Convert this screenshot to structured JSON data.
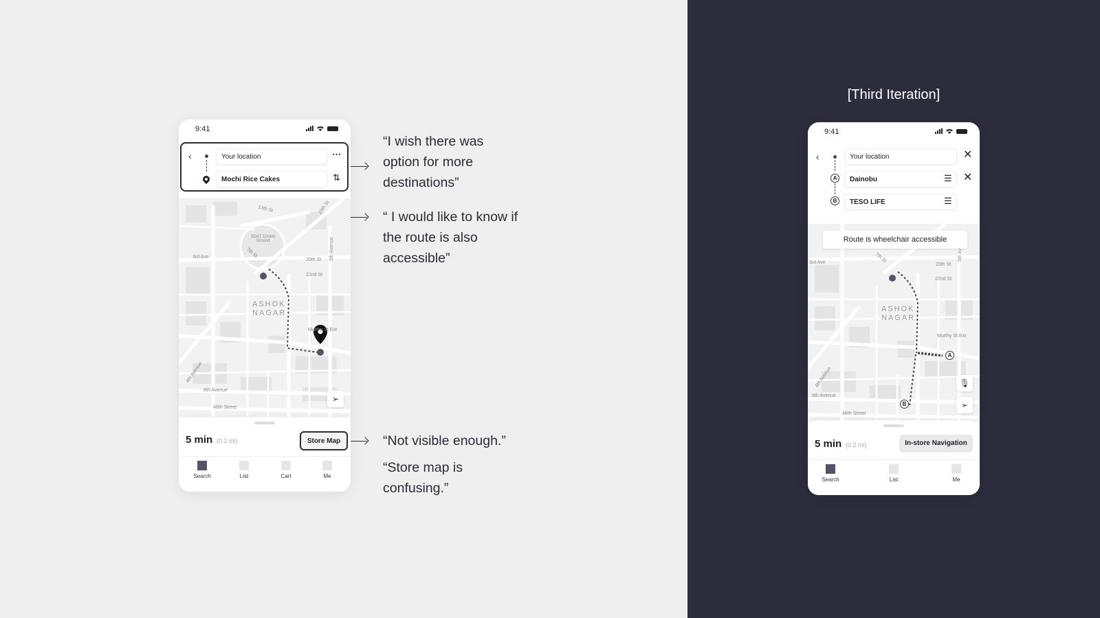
{
  "slide": {
    "iteration_title": "[Third Iteration]"
  },
  "quotes": {
    "q1": "“I wish there was option for more destinations”",
    "q2": "“ I would like to know if the route is also accessible”",
    "q3": "“Not visible enough.”",
    "q4": "“Store map is confusing.”"
  },
  "phone1": {
    "status": {
      "time": "9:41"
    },
    "search": {
      "origin": "Your location",
      "destination": "Mochi Rice Cakes",
      "back_icon": "chevron-left-icon",
      "more_icon": "more-horizontal-icon",
      "swap_icon": "swap-vertical-icon"
    },
    "map": {
      "labels": {
        "street_13th": "13th St",
        "street_15th": "15th St",
        "sdat": "SDAT Cricket Ground",
        "ave_3rd": "3rd Ave",
        "street_7th": "7th St",
        "street_20th": "20th St",
        "ave_5th": "5th Avenue",
        "street_22nd": "22nd St",
        "area": "ASHOK NAGAR",
        "murthy": "Murthy St Ext",
        "ave_4th": "4th Avenue",
        "ave_8th": "8th Avenue",
        "street_46th": "46th Street"
      },
      "locate_icon": "navigation-arrow-icon"
    },
    "sheet": {
      "eta": "5 min",
      "distance": "(0.2 mi)",
      "store_button": "Store Map"
    },
    "nav": [
      {
        "label": "Search",
        "active": true
      },
      {
        "label": "List",
        "active": false
      },
      {
        "label": "Cart",
        "active": false
      },
      {
        "label": "Me",
        "active": false
      }
    ]
  },
  "phone2": {
    "status": {
      "time": "9:41"
    },
    "search": {
      "origin": "Your location",
      "stop_a_badge": "A",
      "stop_a": "Dainobu",
      "stop_b_badge": "B",
      "stop_b": "TESO LIFE",
      "close_icon": "close-icon",
      "drag_icon": "drag-handle-icon"
    },
    "map": {
      "toast": "Route is wheelchair accessible",
      "labels": {
        "ave_3rd": "3rd Ave",
        "street_7th": "7th St",
        "street_20th": "20th St",
        "ave_5th": "5th Ave",
        "street_22nd": "22nd St",
        "area": "ASHOK NAGAR",
        "murthy": "Murthy St Ext",
        "ave_4th": "4th Avenue",
        "ave_8th": "8th Avenue",
        "street_46th": "46th Street"
      },
      "marker_a": "A",
      "marker_b": "B",
      "mic_icon": "microphone-icon",
      "locate_icon": "navigation-arrow-icon"
    },
    "sheet": {
      "eta": "5 min",
      "distance": "(0.2 mi)",
      "store_button": "In-store Navigation"
    },
    "nav": [
      {
        "label": "Search",
        "active": true
      },
      {
        "label": "List",
        "active": false
      },
      {
        "label": "Me",
        "active": false
      }
    ]
  },
  "colors": {
    "light_bg": "#efefef",
    "dark_bg": "#2d2c3c",
    "ink": "#2b2b35",
    "active_tab": "#55526a"
  }
}
